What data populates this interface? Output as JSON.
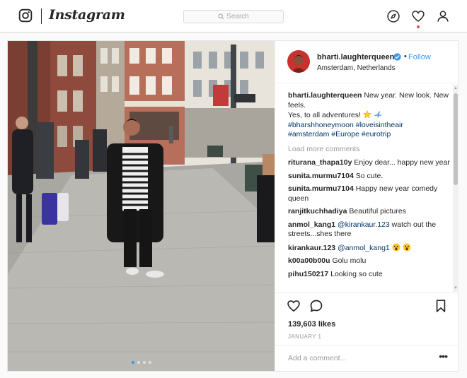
{
  "header": {
    "wordmark": "Instagram",
    "search_placeholder": "Search"
  },
  "post": {
    "username": "bharti.laughterqueen",
    "verified": true,
    "follow_label": "Follow",
    "dot": "•",
    "location": "Amsterdam, Netherlands",
    "caption": {
      "username": "bharti.laughterqueen",
      "text": "New year. New look. New feels.",
      "line2": "Yes, to all adventures!",
      "hashtags_line1": "#bharshhoneymoon #loveisintheair",
      "hashtags_line2": "#amsterdam #Europe #eurotrip"
    },
    "load_more": "Load more comments",
    "comments": [
      {
        "user": "riturana_thapa10y",
        "text": "Enjoy dear... happy new year"
      },
      {
        "user": "sunita.murmu7104",
        "text": "So cute."
      },
      {
        "user": "sunita.murmu7104",
        "text": "Happy new year comedy queen"
      },
      {
        "user": "ranjitkuchhadiya",
        "text": "Beautiful pictures"
      },
      {
        "user": "anmol_kang1",
        "mention": "@kirankaur.123",
        "text": "watch out the streets...shes there"
      },
      {
        "user": "kirankaur.123",
        "mention": "@anmol_kang1"
      },
      {
        "user": "k00a00b00u",
        "text": "Golu molu"
      },
      {
        "user": "pihu150217",
        "text": "Looking so cute"
      }
    ],
    "likes": "139,603 likes",
    "date": "JANUARY 1",
    "add_comment_placeholder": "Add a comment...",
    "more_options": "•••"
  },
  "icons": {
    "logo": "instagram-glyph-icon",
    "search": "search-icon",
    "explore": "compass-icon",
    "activity": "heart-icon",
    "profile": "person-icon",
    "like": "heart-outline-icon",
    "comment": "speech-bubble-icon",
    "save": "bookmark-icon",
    "verified": "verified-badge-icon"
  },
  "colors": {
    "link": "#3897f0",
    "hashtag": "#003569",
    "notification": "#ed4956"
  }
}
